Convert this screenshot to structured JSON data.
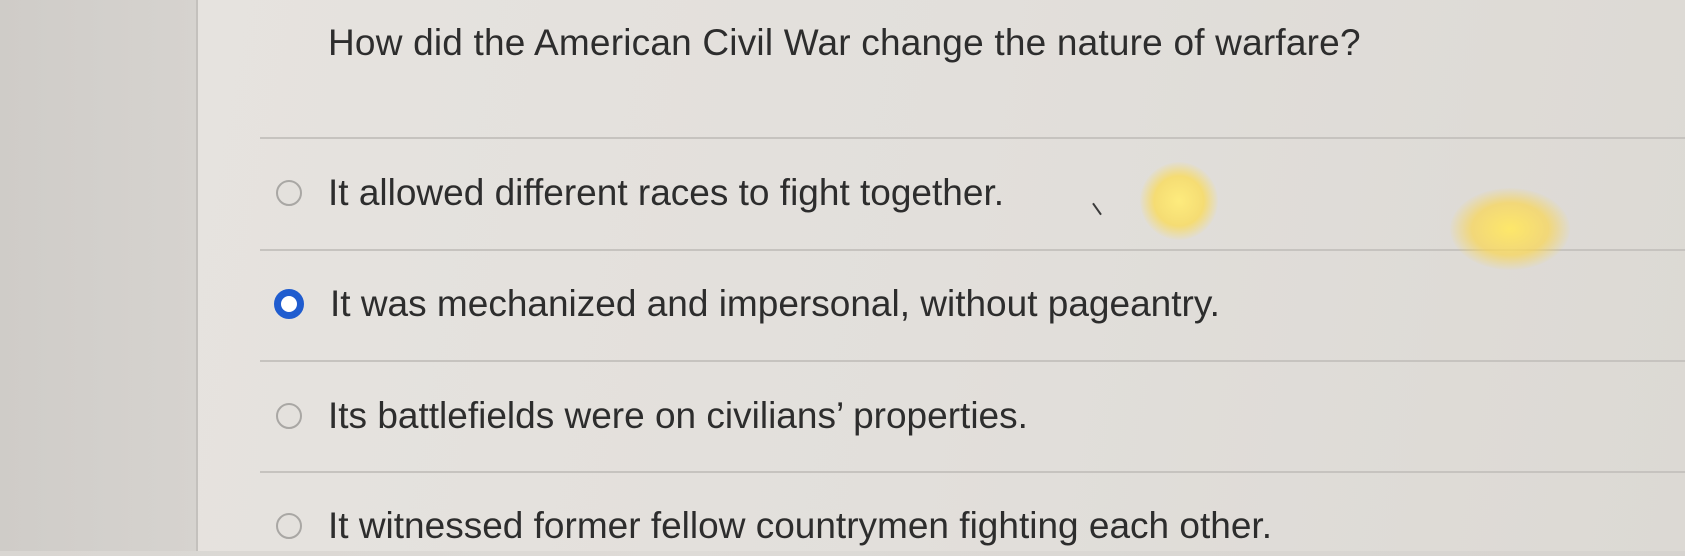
{
  "question": {
    "text": "How did the American Civil War change the nature of warfare?"
  },
  "options": [
    {
      "label": "It allowed different races to fight together.",
      "selected": false
    },
    {
      "label": "It was mechanized and impersonal, without pageantry.",
      "selected": true
    },
    {
      "label": "Its battlefields were on civilians’ properties.",
      "selected": false
    },
    {
      "label": "It witnessed former fellow countrymen fighting each other.",
      "selected": false
    }
  ],
  "colors": {
    "selected_radio": "#1f5ccf",
    "text": "#2d2d2d",
    "divider": "#c6c3bf"
  }
}
